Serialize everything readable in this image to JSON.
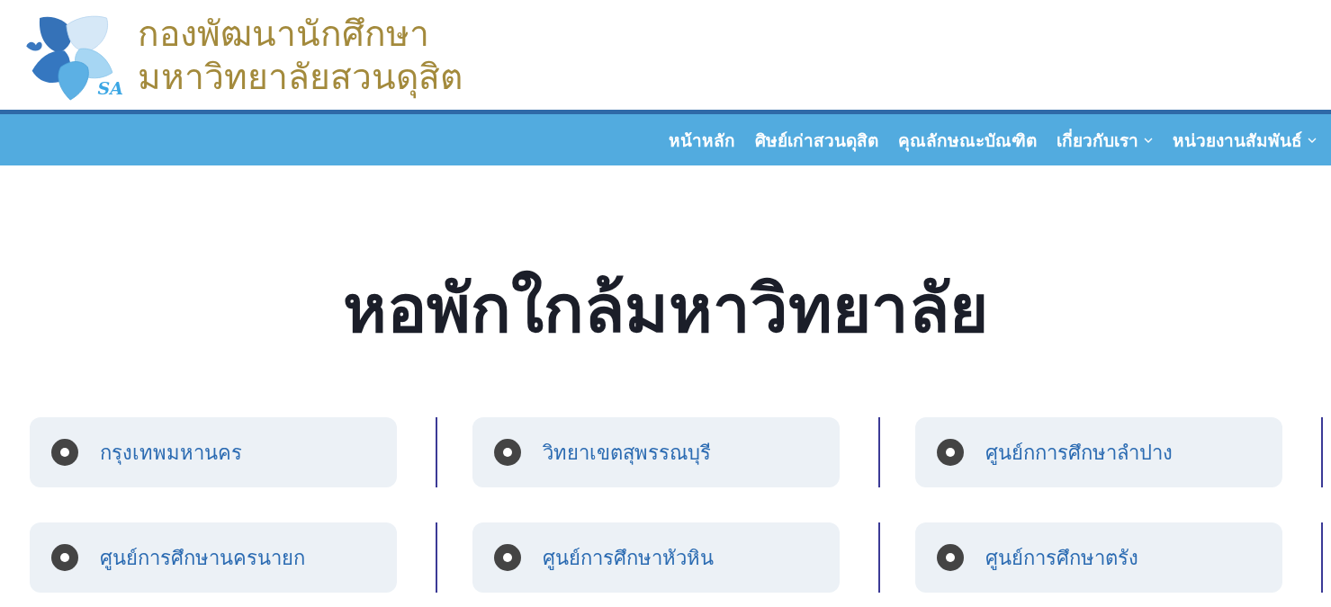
{
  "header": {
    "logo_mark": "SA",
    "site_title": [
      "กองพัฒนานักศึกษา",
      "มหาวิทยาลัยสวนดุสิต"
    ]
  },
  "nav": [
    {
      "label": "หน้าหลัก",
      "dropdown": false
    },
    {
      "label": "ศิษย์เก่าสวนดุสิต",
      "dropdown": false
    },
    {
      "label": "คุณลักษณะบัณฑิต",
      "dropdown": false
    },
    {
      "label": "เกี่ยวกับเรา",
      "dropdown": true
    },
    {
      "label": "หน่วยงานสัมพันธ์",
      "dropdown": true
    }
  ],
  "page_title": "หอพักใกล้มหาวิทยาลัย",
  "locations": [
    {
      "label": "กรุงเทพมหานคร"
    },
    {
      "label": "วิทยาเขตสุพรรณบุรี"
    },
    {
      "label": "ศูนย์กการศึกษาลำปาง"
    },
    {
      "label": "ศูนย์การศึกษานครนายก"
    },
    {
      "label": "ศูนย์การศึกษาหัวหิน"
    },
    {
      "label": "ศูนย์การศึกษาตรัง"
    }
  ]
}
